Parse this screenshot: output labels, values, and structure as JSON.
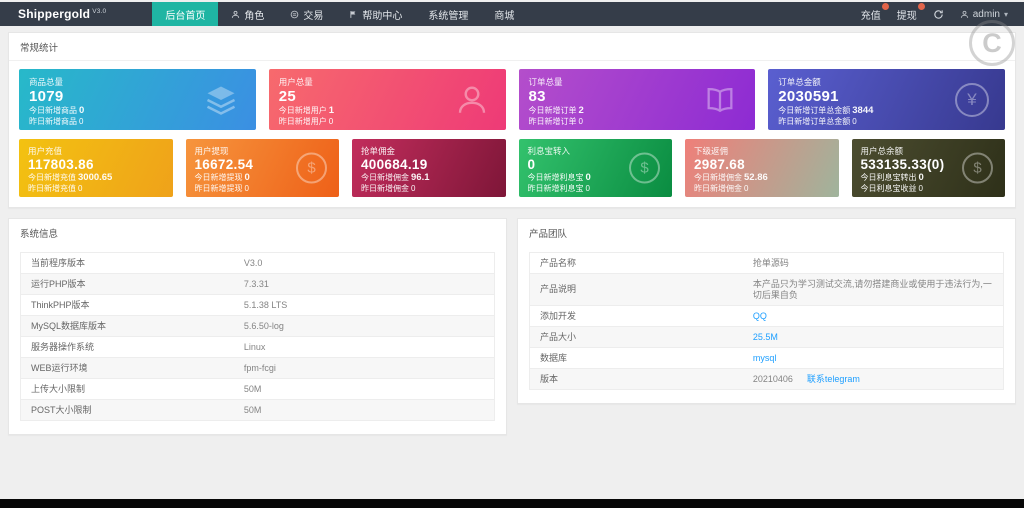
{
  "navbar": {
    "brand": "Shippergold",
    "brand_version": "V3.0",
    "menu": [
      {
        "label": "后台首页"
      },
      {
        "label": "角色"
      },
      {
        "label": "交易"
      },
      {
        "label": "帮助中心"
      },
      {
        "label": "系统管理"
      },
      {
        "label": "商城"
      }
    ],
    "recharge_label": "充值",
    "withdraw_label": "提现",
    "username": "admin"
  },
  "stats": {
    "title": "常规统计",
    "cards": [
      {
        "title": "商品总量",
        "value": "1079",
        "line2_label": "今日新增商品",
        "line2_value": "0",
        "line3_label": "昨日新增商品",
        "line3_value": "0",
        "icon": "layers-icon",
        "colors": [
          "#27b9c9",
          "#3b8fe3"
        ]
      },
      {
        "title": "用户总量",
        "value": "25",
        "line2_label": "今日新增用户",
        "line2_value": "1",
        "line3_label": "昨日新增用户",
        "line3_value": "0",
        "icon": "user-icon",
        "colors": [
          "#f76a6d",
          "#ee3a77"
        ]
      },
      {
        "title": "订单总量",
        "value": "83",
        "line2_label": "今日新增订单",
        "line2_value": "2",
        "line3_label": "昨日新增订单",
        "line3_value": "0",
        "icon": "book-icon",
        "colors": [
          "#b44ecb",
          "#8d2bd3"
        ]
      },
      {
        "title": "订单总金额",
        "value": "2030591",
        "line2_label": "今日新增订单总金额",
        "line2_value": "3844",
        "line3_label": "昨日新增订单总金额",
        "line3_value": "0",
        "icon": "yen-circle-icon",
        "colors": [
          "#5a5fd0",
          "#37398f"
        ]
      },
      {
        "title": "用户充值",
        "value": "117803.86",
        "line2_label": "今日新增充值",
        "line2_value": "3000.65",
        "line3_label": "昨日新增充值",
        "line3_value": "0",
        "icon": "doc-question-icon",
        "colors": [
          "#f3c211",
          "#efa21a"
        ]
      },
      {
        "title": "用户提现",
        "value": "16672.54",
        "line2_label": "今日新增提现",
        "line2_value": "0",
        "line3_label": "昨日新增提现",
        "line3_value": "0",
        "icon": "dollar-circle-icon",
        "colors": [
          "#f6953d",
          "#ee6018"
        ]
      },
      {
        "title": "抢单佣金",
        "value": "400684.19",
        "line2_label": "今日新增佣金",
        "line2_value": "96.1",
        "line3_label": "昨日新增佣金",
        "line3_value": "0",
        "icon": "doc-question-icon",
        "colors": [
          "#c22d5c",
          "#7e1638"
        ]
      },
      {
        "title": "利息宝转入",
        "value": "0",
        "line2_label": "今日新增利息宝",
        "line2_value": "0",
        "line3_label": "昨日新增利息宝",
        "line3_value": "0",
        "icon": "dollar-circle-icon",
        "colors": [
          "#33c26d",
          "#0a8c41"
        ]
      },
      {
        "title": "下级返佣",
        "value": "2987.68",
        "line2_label": "今日新增佣金",
        "line2_value": "52.86",
        "line3_label": "昨日新增佣金",
        "line3_value": "0",
        "icon": "doc-question-icon",
        "colors": [
          "#ef7f79",
          "#9fb49c"
        ]
      },
      {
        "title": "用户总余额",
        "value": "533135.33(0)",
        "line2_label": "今日利息宝转出",
        "line2_value": "0",
        "line3_label": "今日利息宝收益",
        "line3_value": "0",
        "icon": "dollar-circle-icon",
        "colors": [
          "#4c4d30",
          "#2e3019"
        ]
      }
    ]
  },
  "system_info": {
    "title": "系统信息",
    "rows": [
      {
        "label": "当前程序版本",
        "value": "V3.0"
      },
      {
        "label": "运行PHP版本",
        "value": "7.3.31"
      },
      {
        "label": "ThinkPHP版本",
        "value": "5.1.38 LTS"
      },
      {
        "label": "MySQL数据库版本",
        "value": "5.6.50-log"
      },
      {
        "label": "服务器操作系统",
        "value": "Linux"
      },
      {
        "label": "WEB运行环境",
        "value": "fpm-fcgi"
      },
      {
        "label": "上传大小限制",
        "value": "50M"
      },
      {
        "label": "POST大小限制",
        "value": "50M"
      }
    ]
  },
  "product_team": {
    "title": "产品团队",
    "rows": [
      {
        "label": "产品名称",
        "value": "抢单源码"
      },
      {
        "label": "产品说明",
        "value": "本产品只为学习测试交流,请勿搭建商业或使用于违法行为,一切后果自负"
      },
      {
        "label": "添加开发",
        "value": "QQ"
      },
      {
        "label": "产品大小",
        "value": "25.5M"
      },
      {
        "label": "数据库",
        "value": "mysql"
      },
      {
        "label": "版本",
        "value": "20210406",
        "extra_link": "联系telegram"
      }
    ]
  },
  "watermark": "C"
}
